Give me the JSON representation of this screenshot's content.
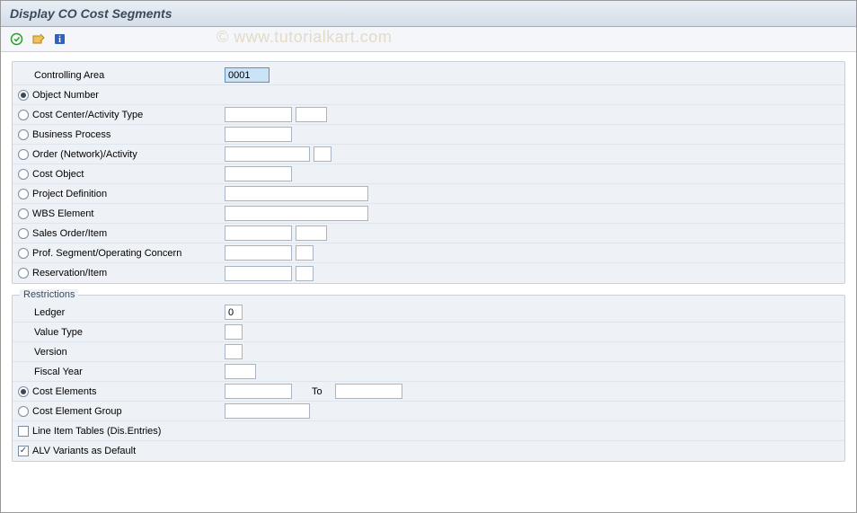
{
  "title": "Display CO Cost Segments",
  "watermark": "© www.tutorialkart.com",
  "top": {
    "controlling_area_label": "Controlling Area",
    "controlling_area_value": "0001",
    "radios": {
      "object_number": "Object Number",
      "cost_center_activity": "Cost Center/Activity Type",
      "business_process": "Business Process",
      "order_network": "Order (Network)/Activity",
      "cost_object": "Cost Object",
      "project_definition": "Project Definition",
      "wbs_element": "WBS Element",
      "sales_order_item": "Sales Order/Item",
      "prof_segment": "Prof. Segment/Operating Concern",
      "reservation_item": "Reservation/Item"
    }
  },
  "restrictions": {
    "title": "Restrictions",
    "ledger_label": "Ledger",
    "ledger_value": "0",
    "value_type_label": "Value Type",
    "version_label": "Version",
    "fiscal_year_label": "Fiscal Year",
    "cost_elements_label": "Cost Elements",
    "to_label": "To",
    "cost_element_group_label": "Cost Element Group",
    "line_item_tables_label": "Line Item Tables (Dis.Entries)",
    "alv_variants_label": "ALV Variants as Default"
  }
}
